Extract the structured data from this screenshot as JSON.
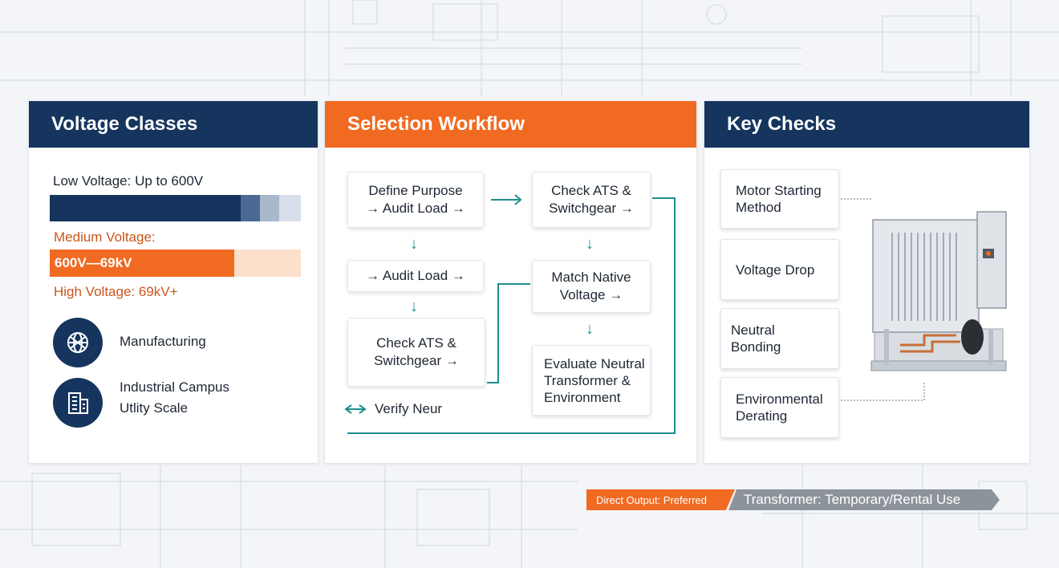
{
  "panels": {
    "voltage": {
      "title": "Voltage Classes",
      "low_label": "Low Voltage: Up to 600V",
      "medium_label": "Medium Voltage:",
      "medium_range": "600V—69kV",
      "high_label": "High Voltage: 69kV+",
      "apps": [
        {
          "label": "Manufacturing"
        },
        {
          "label": "Industrial Campus\nUtlity Scale"
        }
      ]
    },
    "workflow": {
      "title": "Selection Workflow",
      "steps": {
        "define": "Define Purpose\n→ Audit Load →",
        "audit": "→ Audit Load →",
        "check_left": "Check ATS &\nSwitchgear →",
        "verify": "Verify Neur",
        "check_right": "Check ATS &\nSwitchgear →",
        "match": "Match Native\nVoltage →",
        "evaluate": "Evaluate Neutral\nTransformer &\nEnvironment"
      }
    },
    "checks": {
      "title": "Key Checks",
      "items": [
        {
          "label": "Motor Starting\nMethod"
        },
        {
          "label": "Voltage Drop"
        },
        {
          "label": "Neutral Bonding"
        },
        {
          "label": "Environmental\nDerating"
        }
      ]
    }
  },
  "banner": {
    "left": "Direct Output: Preferred",
    "right": "Transformer: Temporary/Rental Use"
  },
  "colors": {
    "navy": "#15355e",
    "orange": "#f06a22",
    "teal": "#1f8f8e",
    "medium_text": "#c9561b"
  },
  "icons": {
    "manufacturing": "globe-gear-icon",
    "industrial": "building-icon",
    "equipment": "transformer-icon"
  }
}
